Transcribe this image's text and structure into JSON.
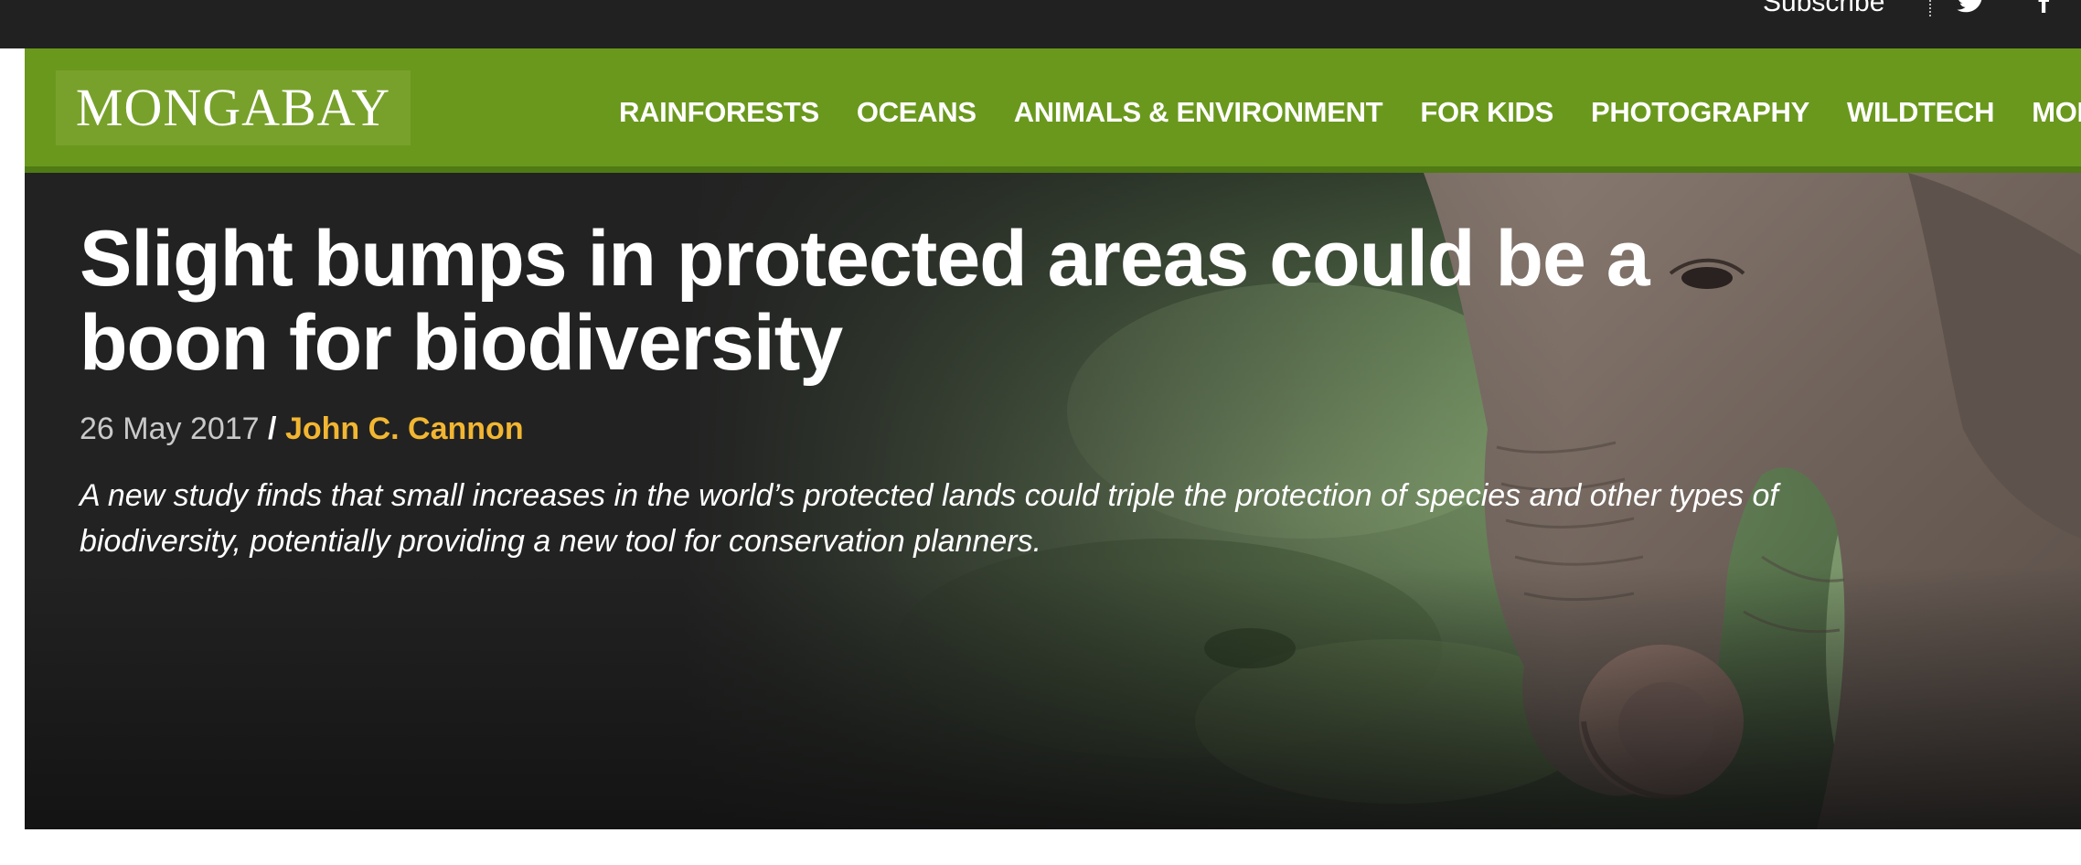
{
  "topbar": {
    "subscribe_label": "Subscribe",
    "social": [
      "twitter-icon",
      "facebook-icon"
    ]
  },
  "site": {
    "logo_text": "MONGABAY",
    "brand_green": "#6a981d",
    "accent_gold": "#f2b632"
  },
  "nav": {
    "items": [
      {
        "label": "RAINFORESTS"
      },
      {
        "label": "OCEANS"
      },
      {
        "label": "ANIMALS & ENVIRONMENT"
      },
      {
        "label": "FOR KIDS"
      },
      {
        "label": "PHOTOGRAPHY"
      },
      {
        "label": "WILDTECH"
      },
      {
        "label": "MORE"
      }
    ]
  },
  "article": {
    "title": "Slight bumps in protected areas could be a boon for biodiversity",
    "date": "26 May 2017",
    "separator": "/",
    "author": "John C. Cannon",
    "summary": "A new study finds that small increases in the world’s protected lands could triple the protection of species and other types of biodiversity, potentially providing a new tool for conservation planners.",
    "hero_image": "elephant-photo"
  }
}
